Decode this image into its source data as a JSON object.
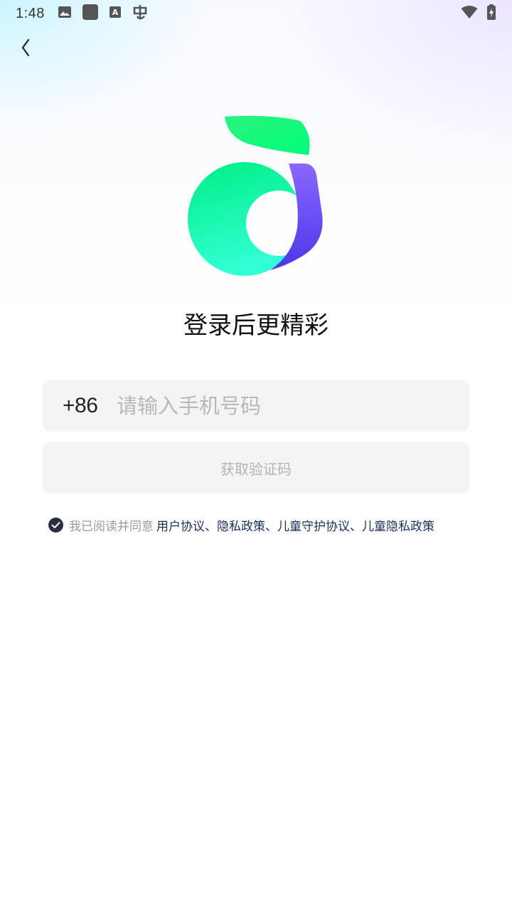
{
  "status_bar": {
    "time": "1:48",
    "left_icons": [
      "image-icon",
      "app-square-icon",
      "keyboard-a-icon",
      "bug-icon"
    ],
    "right_icons": [
      "wifi-icon",
      "battery-charging-icon"
    ]
  },
  "header": {
    "back_icon": "chevron-left-icon"
  },
  "logo": {
    "name": "app-logo",
    "colors": {
      "green_top": "#00ff7b",
      "green_bottom": "#33ffd6",
      "purple": "#6b4df5"
    }
  },
  "title": "登录后更精彩",
  "form": {
    "country_code": "+86",
    "phone_placeholder": "请输入手机号码",
    "phone_value": "",
    "get_code_label": "获取验证码"
  },
  "agreement": {
    "checked": true,
    "prefix": "我已阅读并同意",
    "links": [
      "用户协议",
      "隐私政策",
      "儿童守护协议",
      "儿童隐私政策"
    ],
    "separator": "、"
  }
}
